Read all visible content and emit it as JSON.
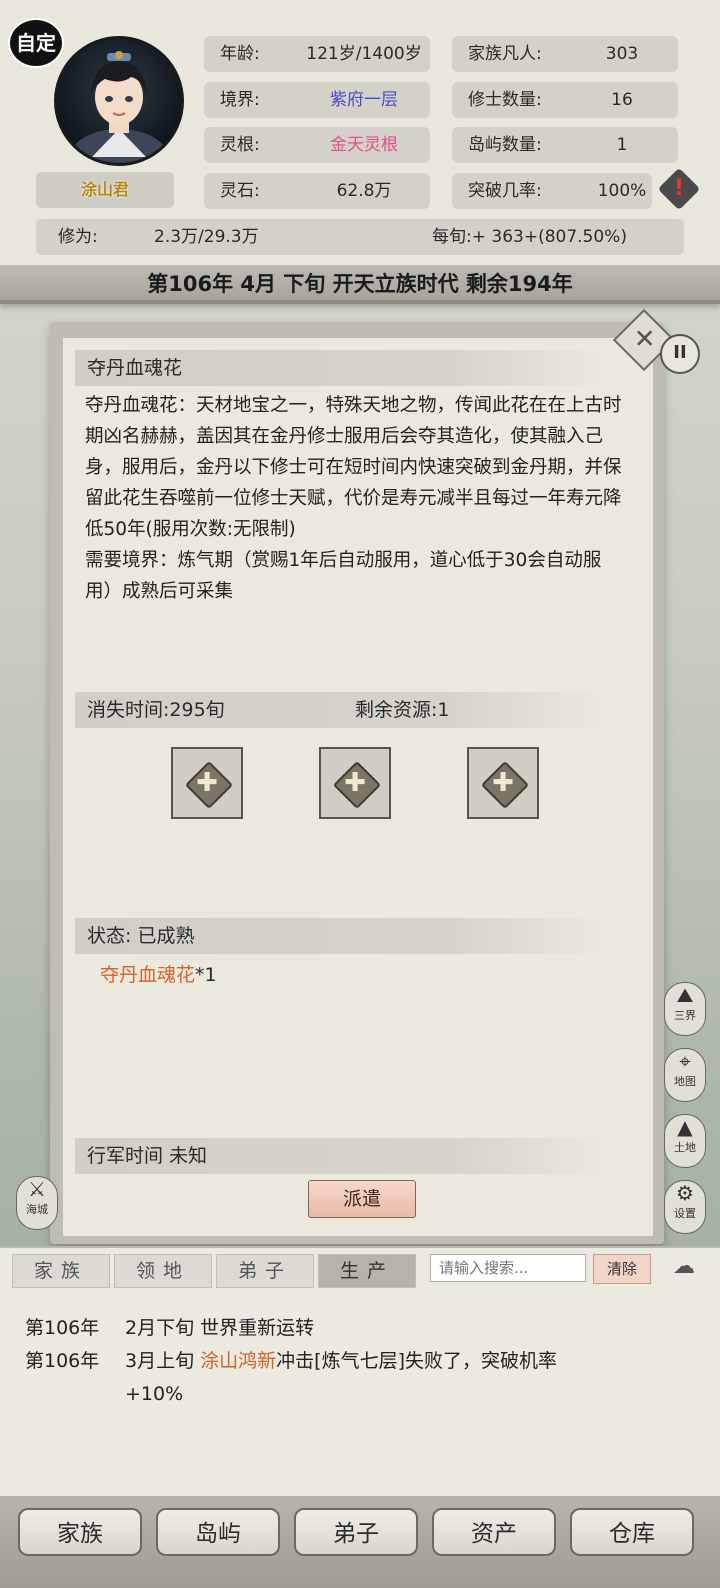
{
  "header": {
    "custom_badge": "自定",
    "name": "涂山君",
    "stats_left": [
      {
        "label": "年龄:",
        "value": "121岁/1400岁",
        "color": "#2a2a2a"
      },
      {
        "label": "境界:",
        "value": "紫府一层",
        "color": "#4a4ad0"
      },
      {
        "label": "灵根:",
        "value": "金天灵根",
        "color": "#e0508a"
      },
      {
        "label": "灵石:",
        "value": "62.8万",
        "color": "#2a2a2a"
      }
    ],
    "stats_right": [
      {
        "label": "家族凡人:",
        "value": "303"
      },
      {
        "label": "修士数量:",
        "value": "16"
      },
      {
        "label": "岛屿数量:",
        "value": "1"
      },
      {
        "label": "突破几率:",
        "value": "100%"
      }
    ],
    "xiuwei_label": "修为:",
    "xiuwei_value": "2.3万/29.3万",
    "per_xun": "每旬:+ 363+(807.50%)",
    "era_text": "第106年 4月 下旬  开天立族时代 剩余194年"
  },
  "dialog": {
    "title": "夺丹血魂花",
    "description": "夺丹血魂花：天材地宝之一，特殊天地之物，传闻此花在在上古时期凶名赫赫，盖因其在金丹修士服用后会夺其造化，使其融入己身，服用后，金丹以下修士可在短时间内快速突破到金丹期，并保留此花生吞噬前一位修士天赋，代价是寿元减半且每过一年寿元降低50年(服用次数:无限制)",
    "requirement": "需要境界：炼气期（赏赐1年后自动服用，道心低于30会自动服用）成熟后可采集",
    "vanish_time": "消失时间:295旬",
    "remaining": "剩余资源:1",
    "slot_plus": "✚",
    "status_label": "状态:  已成熟",
    "harvest_item": "夺丹血魂花",
    "harvest_count": "*1",
    "march_label": "行军时间     未知",
    "dispatch_label": "派遣"
  },
  "side_icons": [
    "三界",
    "地图",
    "土地",
    "设置"
  ],
  "side_left_icon": "海城",
  "log_tabs": [
    {
      "label": "家族",
      "active": false
    },
    {
      "label": "领地",
      "active": false
    },
    {
      "label": "弟子",
      "active": false
    },
    {
      "label": "生产",
      "active": true
    }
  ],
  "search": {
    "placeholder": "请输入搜索...",
    "clear_label": "清除"
  },
  "logs": [
    {
      "year": "第106年",
      "text_pre": "2月下旬 世界重新运转",
      "highlight": "",
      "text_post": ""
    },
    {
      "year": "第106年",
      "text_pre": "3月上旬 ",
      "highlight": "涂山鸿新",
      "text_post": "冲击[炼气七层]失败了，突破机率"
    },
    {
      "year": "",
      "text_pre": "+10%",
      "highlight": "",
      "text_post": ""
    }
  ],
  "bottom_nav": [
    "家族",
    "岛屿",
    "弟子",
    "资产",
    "仓库"
  ]
}
